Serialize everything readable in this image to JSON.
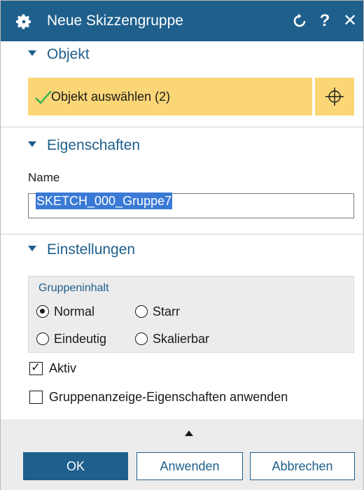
{
  "title_bar": {
    "title": "Neue Skizzengruppe",
    "reset_icon": "reset-icon",
    "help_label": "?",
    "close_label": "✕",
    "accent": "#1e5f8c"
  },
  "sections": {
    "object": {
      "label": "Objekt"
    },
    "properties": {
      "label": "Eigenschaften"
    },
    "settings": {
      "label": "Einstellungen"
    }
  },
  "object_selection": {
    "label": "Objekt auswählen (2)",
    "status_icon": "checkmark-icon",
    "select_icon": "crosshair-icon",
    "highlight": "#fbd676"
  },
  "properties": {
    "name_label": "Name",
    "name_value": "SKETCH_000_Gruppe7"
  },
  "group_content": {
    "title": "Gruppeninhalt",
    "options": [
      {
        "label": "Normal",
        "selected": true
      },
      {
        "label": "Starr",
        "selected": false
      },
      {
        "label": "Eindeutig",
        "selected": false
      },
      {
        "label": "Skalierbar",
        "selected": false
      }
    ]
  },
  "checkboxes": {
    "active": {
      "label": "Aktiv",
      "checked": true
    },
    "apply_display": {
      "label": "Gruppenanzeige-Eigenschaften anwenden",
      "checked": false
    }
  },
  "buttons": {
    "ok": "OK",
    "apply": "Anwenden",
    "cancel": "Abbrechen"
  }
}
